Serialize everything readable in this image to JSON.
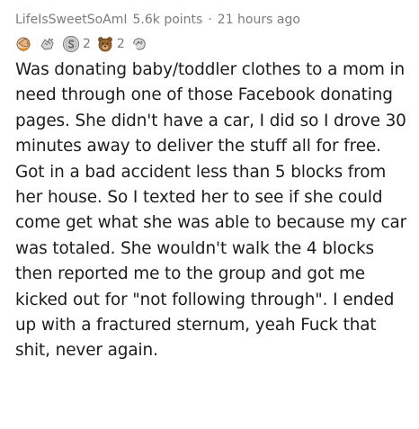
{
  "comment": {
    "author": "LifeIsSweetSoAmI",
    "points": "5.6k points",
    "separator": "·",
    "time": "21 hours ago",
    "awards": [
      {
        "icon": "facepalm-award-icon",
        "count": ""
      },
      {
        "icon": "bravo-award-icon",
        "count": ""
      },
      {
        "icon": "silver-coin-award-icon",
        "count": "2"
      },
      {
        "icon": "bear-award-icon",
        "count": "2"
      },
      {
        "icon": "hugz-award-icon",
        "count": ""
      }
    ],
    "body": "Was donating baby/toddler clothes to a mom in need through one of those Facebook donating pages. She didn't have a car, I did so I drove 30 minutes away to deliver the stuff all for free. Got in a bad accident less than 5 blocks from her house. So I texted her to see if she could come get what she was able to because my car was totaled. She wouldn't walk the 4 blocks then reported me to the group and got me kicked out for \"not following through\". I ended up with a fractured sternum, yeah Fuck that shit, never again."
  }
}
